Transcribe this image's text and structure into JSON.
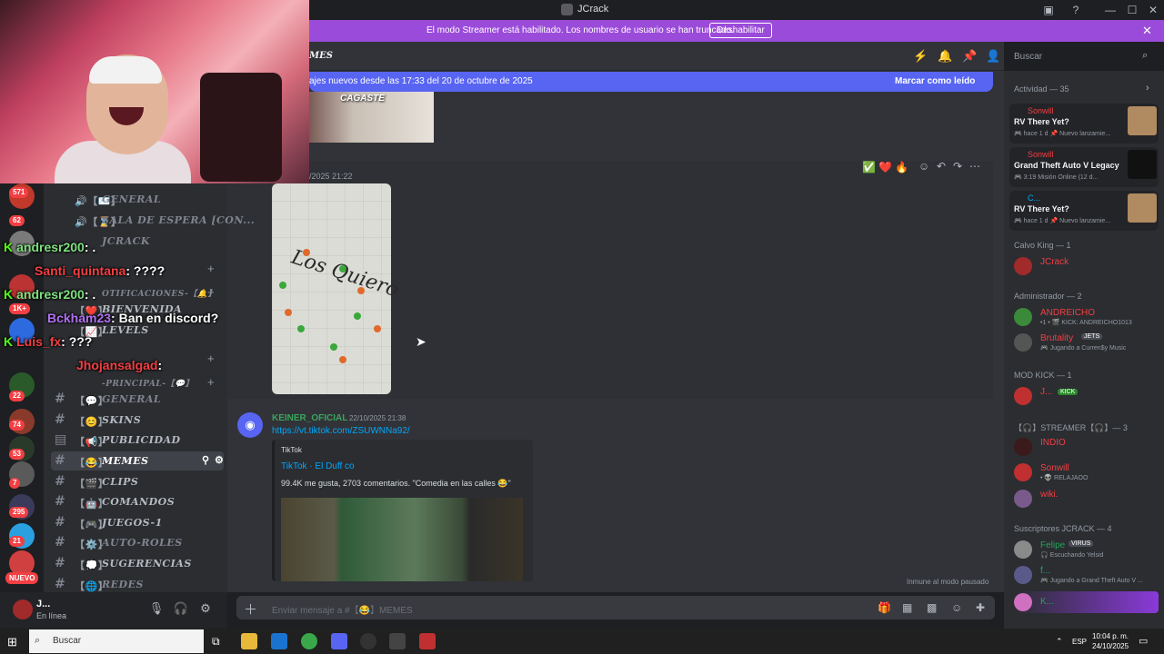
{
  "window": {
    "title": "JCrack"
  },
  "banner": {
    "text": "El modo Streamer está habilitado. Los nombres de usuario se han truncado.",
    "button": "Deshabilitar",
    "close": "✕"
  },
  "header": {
    "channel_fragment": "MES",
    "search_placeholder": "Buscar"
  },
  "new_messages": {
    "text": "ajes nuevos desde las 17:33 del 20 de octubre de 2025",
    "action": "Marcar como leído"
  },
  "messages": {
    "image_caption": "CAGASTE",
    "top_timestamp": "/2025 21:22",
    "image_text": "Los Quiero",
    "reactions": [
      "✅",
      "❤️",
      "🔥"
    ],
    "author": "KEINER_OFICIAL",
    "timestamp": "22/10/2025 21:38",
    "link": "https://vt.tiktok.com/ZSUWNNa92/",
    "embed_provider": "TikTok",
    "embed_title": "TikTok · El Duff co",
    "embed_desc": "99.4K me gusta, 2703 comentarios. \"Comedia en las calles 😂\"",
    "immune_note": "Inmune al modo pausado"
  },
  "input": {
    "placeholder": "Enviar mensaje a #【😂】MEMES"
  },
  "sidebar": {
    "channels": [
      {
        "prefix": "🔊【✉️】",
        "name": "GENERAL"
      },
      {
        "prefix": "🔊【⌛】",
        "name": "SALA DE ESPERA [CON..."
      },
      {
        "prefix": "",
        "name": "JCRACK"
      },
      {
        "prefix": "",
        "name": "OTIFICACIONES-【🔔】"
      },
      {
        "prefix": "【❤️】",
        "name": "BIENVENIDA"
      },
      {
        "prefix": "【📈】",
        "name": "LEVELS"
      },
      {
        "prefix": "【💬】",
        "name": "-PRINCIPAL-【💬】"
      },
      {
        "prefix": "【💬】",
        "name": "GENERAL"
      },
      {
        "prefix": "【😊】",
        "name": "SKINS"
      },
      {
        "prefix": "【📢】",
        "name": "PUBLICIDAD"
      },
      {
        "prefix": "【😂】",
        "name": "MEMES"
      },
      {
        "prefix": "【🎬】",
        "name": "CLIPS"
      },
      {
        "prefix": "【🤖】",
        "name": "COMANDOS"
      },
      {
        "prefix": "【🎮】",
        "name": "JUEGOS-1"
      },
      {
        "prefix": "【⚙️】",
        "name": "AUTO-ROLES"
      },
      {
        "prefix": "【💭】",
        "name": "SUGERENCIAS"
      },
      {
        "prefix": "【🌐】",
        "name": "REDES"
      }
    ],
    "server_badges": [
      "571",
      "62",
      "1K+",
      "22",
      "74",
      "53",
      "7",
      "295",
      "21"
    ],
    "nuevo": "NUEVO"
  },
  "user_panel": {
    "name": "J...",
    "status": "En línea"
  },
  "stream_chat": [
    {
      "user": "andresr200",
      "msg": ": ."
    },
    {
      "user": "Santi_quintana",
      "msg": ": ????"
    },
    {
      "user": "andresr200",
      "msg": ": ."
    },
    {
      "user": "Bckham23",
      "msg": ": Ban en discord?"
    },
    {
      "user": "Luis_fx",
      "msg": ": ???"
    },
    {
      "user": "Jhojansalgad",
      "msg": ":"
    }
  ],
  "members": {
    "activity_header": "Actividad — 35",
    "activities": [
      {
        "name": "Sonwill",
        "game": "RV There Yet?",
        "meta": "🎮 hace 1 d  📌 Nuevo lanzamie..."
      },
      {
        "name": "Sonwill",
        "game": "Grand Theft Auto V Legacy",
        "meta": "🎮 3:19  Misión Online (12 d..."
      },
      {
        "name": "C...",
        "game": "RV There Yet?",
        "meta": "🎮 hace 1 d  📌 Nuevo lanzamie..."
      }
    ],
    "groups": [
      {
        "header": "Calvo King — 1",
        "rows": [
          {
            "name": "JCrack",
            "sub": ""
          }
        ]
      },
      {
        "header": "Administrador — 2",
        "rows": [
          {
            "name": "ANDREICHO",
            "sub": "•1 • 🎬 KICK: ANDREICHO1013"
          },
          {
            "name": "Brutality",
            "sub": "🎮 Jugando a Curren$y Music"
          }
        ]
      },
      {
        "header": "MOD KICK — 1",
        "rows": [
          {
            "name": "J...",
            "sub": ""
          }
        ]
      },
      {
        "header": "【🎧】STREAMER【🎧】— 3",
        "rows": [
          {
            "name": "INDIO",
            "sub": ""
          },
          {
            "name": "Sonwill",
            "sub": "• 👽 RELAJAOO"
          },
          {
            "name": "wiki.",
            "sub": ""
          }
        ]
      },
      {
        "header": "Suscriptores JCRACK — 4",
        "rows": [
          {
            "name": "Felipe",
            "sub": "🎧 Escuchando Yelsid"
          },
          {
            "name": "f...",
            "sub": "🎮 Jugando a Grand Theft Auto V ..."
          },
          {
            "name": "K...",
            "sub": ""
          }
        ]
      }
    ],
    "tags": {
      "brutality": "JETS",
      "mod": "KICK",
      "felipe": "VIRUS"
    }
  },
  "taskbar": {
    "search": "Buscar",
    "lang": "ESP",
    "time": "10:04 p. m.",
    "date": "24/10/2025"
  },
  "colors": {
    "accent": "#5865f2",
    "banner": "#9b4bd9",
    "danger": "#f23f43",
    "online": "#23a55a"
  }
}
